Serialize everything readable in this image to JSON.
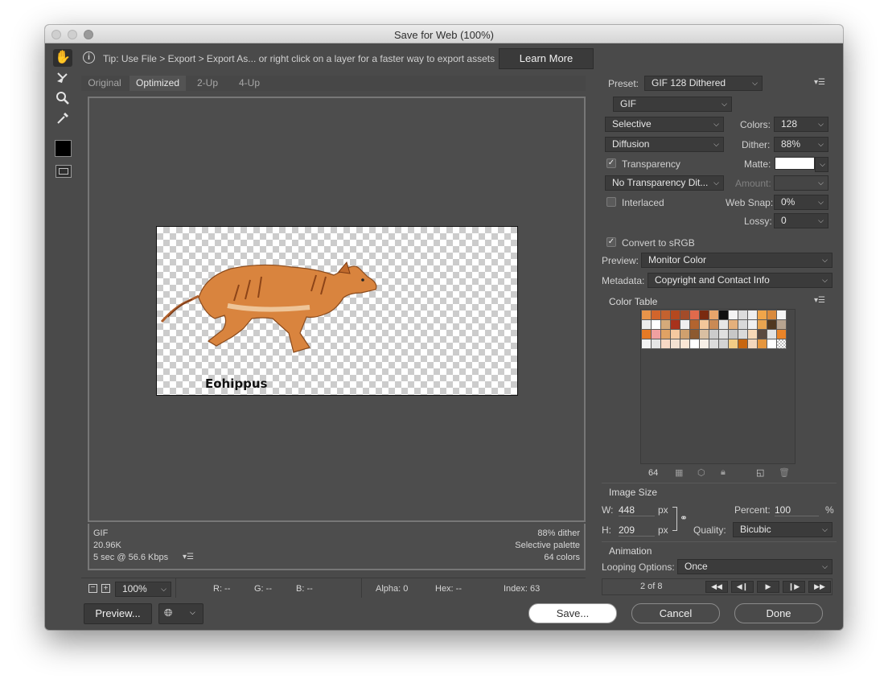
{
  "window": {
    "title": "Save for Web (100%)"
  },
  "tip": {
    "text": "Tip: Use File > Export > Export As...  or right click on a layer for a faster way to export assets",
    "learn_more": "Learn More"
  },
  "tabs": [
    "Original",
    "Optimized",
    "2-Up",
    "4-Up"
  ],
  "active_tab": "Optimized",
  "image": {
    "caption": "Eohippus"
  },
  "preview_info": {
    "format": "GIF",
    "size": "20.96K",
    "time": "5 sec @ 56.6 Kbps",
    "dither": "88% dither",
    "palette": "Selective palette",
    "colors": "64 colors"
  },
  "status_bar": {
    "zoom": "100%",
    "r": "R: --",
    "g": "G: --",
    "b": "B: --",
    "alpha": "Alpha: 0",
    "hex": "Hex: --",
    "index": "Index: 63"
  },
  "footer": {
    "preview": "Preview...",
    "save": "Save...",
    "cancel": "Cancel",
    "done": "Done"
  },
  "settings": {
    "preset_label": "Preset:",
    "preset": "GIF 128 Dithered",
    "format": "GIF",
    "reduction": "Selective",
    "colors_label": "Colors:",
    "colors": "128",
    "dither_algo": "Diffusion",
    "dither_label": "Dither:",
    "dither": "88%",
    "transparency_label": "Transparency",
    "transparency_checked": true,
    "matte_label": "Matte:",
    "trans_dither": "No Transparency Dit...",
    "amount_label": "Amount:",
    "interlaced_label": "Interlaced",
    "interlaced_checked": false,
    "websnap_label": "Web Snap:",
    "websnap": "0%",
    "lossy_label": "Lossy:",
    "lossy": "0",
    "srgb_label": "Convert to sRGB",
    "srgb_checked": true,
    "preview_label": "Preview:",
    "preview": "Monitor Color",
    "metadata_label": "Metadata:",
    "metadata": "Copyright and Contact Info"
  },
  "color_table": {
    "title": "Color Table",
    "count": "64",
    "colors": [
      "#e8944a",
      "#d2652c",
      "#c4622f",
      "#b5491f",
      "#a24c2a",
      "#e06a4c",
      "#7a2a10",
      "#e8a56b",
      "#111111",
      "#f4f4f4",
      "#dcdcdc",
      "#eeeeee",
      "#f0a54a",
      "#d98a3d",
      "#f6f6f6",
      "#ececec",
      "#ffffff",
      "#d5aa7a",
      "#a8321c",
      "#efefef",
      "#b2642f",
      "#f2c79a",
      "#ca8a55",
      "#e7e7e7",
      "#e4b07c",
      "#d9d9d9",
      "#f1f1f1",
      "#e8a450",
      "#503820",
      "#b7a490",
      "#e67a26",
      "#f0a0a0",
      "#e0a264",
      "#f5c9a0",
      "#cfa06e",
      "#8d5a30",
      "#d9bfa2",
      "#cccccc",
      "#e0e0e0",
      "#c7c7c7",
      "#dadada",
      "#f7d8b7",
      "#5a4a40",
      "#e2e2e2",
      "#ea8428",
      "#f3f3f3",
      "#e6e6e6",
      "#f8d9c6",
      "#f4e2d2",
      "#fbe7d5",
      "#ffffff",
      "#f7efe6",
      "#dddddd",
      "#d4d4d4",
      "#f2cc86",
      "#c8660f",
      "#f3d7bd",
      "#e5963e",
      "#ffffff",
      "#transparent"
    ]
  },
  "image_size": {
    "title": "Image Size",
    "w_label": "W:",
    "w": "448",
    "h_label": "H:",
    "h": "209",
    "unit": "px",
    "percent_label": "Percent:",
    "percent": "100",
    "percent_unit": "%",
    "quality_label": "Quality:",
    "quality": "Bicubic"
  },
  "animation": {
    "title": "Animation",
    "looping_label": "Looping Options:",
    "looping": "Once",
    "frame": "2 of 8"
  }
}
